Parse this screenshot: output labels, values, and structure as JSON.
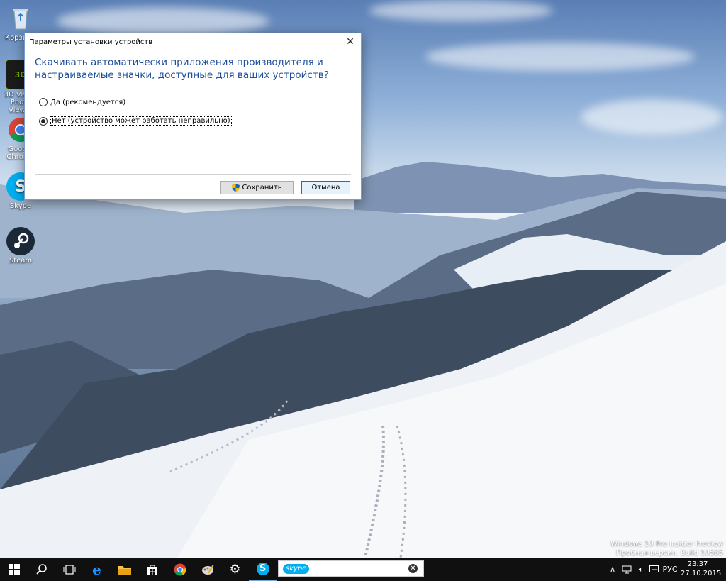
{
  "desktop": {
    "icons": [
      {
        "label": "Корзина",
        "icon": "recycle-bin-icon"
      },
      {
        "label": "3D Vision Photo Viewer",
        "icon": "3d-vision-icon"
      },
      {
        "label": "Google Chrome",
        "icon": "chrome-icon"
      },
      {
        "label": "Skype",
        "icon": "skype-icon"
      },
      {
        "label": "Steam",
        "icon": "steam-icon"
      }
    ]
  },
  "dialog": {
    "title": "Параметры установки устройств",
    "question": "Скачивать автоматически приложения производителя и настраиваемые значки, доступные для ваших устройств?",
    "options": [
      {
        "label": "Да (рекомендуется)",
        "selected": false
      },
      {
        "label": "Нет (устройство может работать неправильно)",
        "selected": true
      }
    ],
    "save_label": "Сохранить",
    "cancel_label": "Отмена"
  },
  "watermark": {
    "line1": "Windows 10 Pro Insider Preview",
    "line2": "Пробная версия. Build 10565"
  },
  "taskbar": {
    "search_logo": "skype",
    "pinned": [
      "edge-icon",
      "file-explorer-icon",
      "store-icon",
      "chrome-icon",
      "paint-icon",
      "settings-icon",
      "skype-icon"
    ],
    "tray": {
      "language": "РУС",
      "time": "23:37",
      "date": "27.10.2015"
    }
  },
  "colors": {
    "dialog_heading": "#1e4f9a",
    "taskbar": "#101010",
    "accent": "#0078d7"
  }
}
